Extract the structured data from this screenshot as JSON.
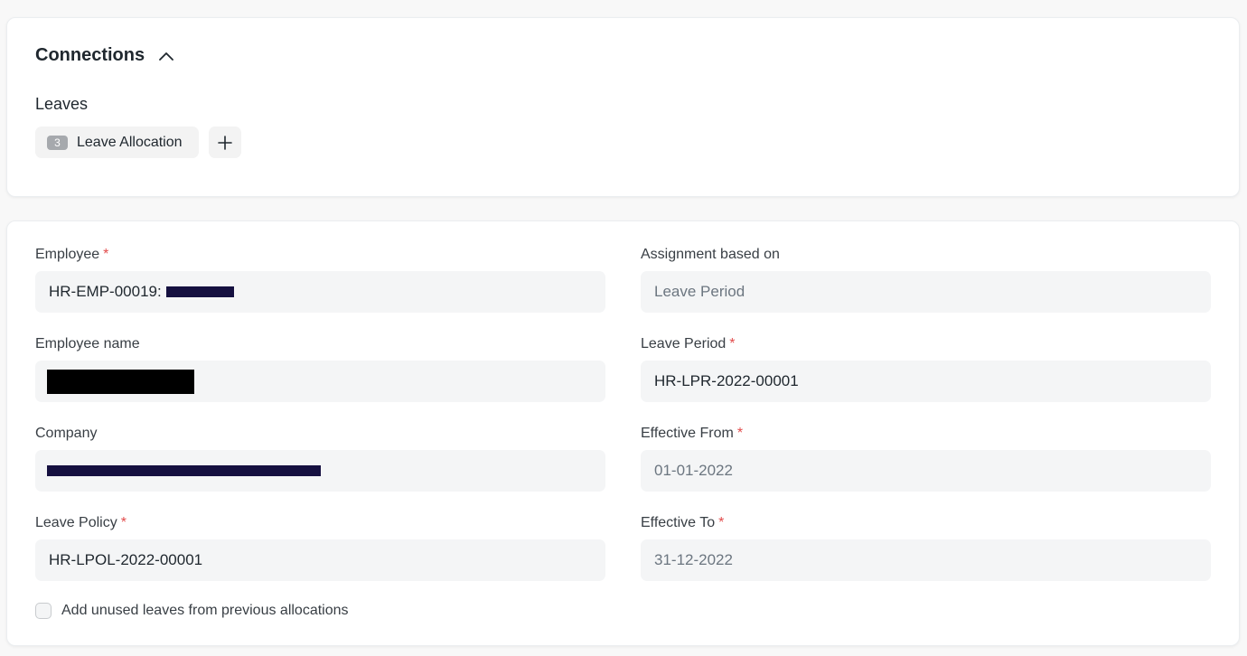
{
  "connections": {
    "title": "Connections",
    "section_label": "Leaves",
    "leave_allocation": {
      "count": "3",
      "label": "Leave Allocation"
    }
  },
  "form": {
    "employee": {
      "label": "Employee",
      "required": "*",
      "value_prefix": "HR-EMP-00019:"
    },
    "employee_name": {
      "label": "Employee name"
    },
    "company": {
      "label": "Company"
    },
    "leave_policy": {
      "label": "Leave Policy",
      "required": "*",
      "value": "HR-LPOL-2022-00001"
    },
    "assignment_based_on": {
      "label": "Assignment based on",
      "value": "Leave Period"
    },
    "leave_period": {
      "label": "Leave Period",
      "required": "*",
      "value": "HR-LPR-2022-00001"
    },
    "effective_from": {
      "label": "Effective From",
      "required": "*",
      "value": "01-01-2022"
    },
    "effective_to": {
      "label": "Effective To",
      "required": "*",
      "value": "31-12-2022"
    },
    "carry_forward": {
      "label": "Add unused leaves from previous allocations",
      "checked": false
    }
  },
  "colors": {
    "required": "#e24c4c",
    "input_bg": "#f4f5f6",
    "badge_bg": "#a6a9ad"
  }
}
